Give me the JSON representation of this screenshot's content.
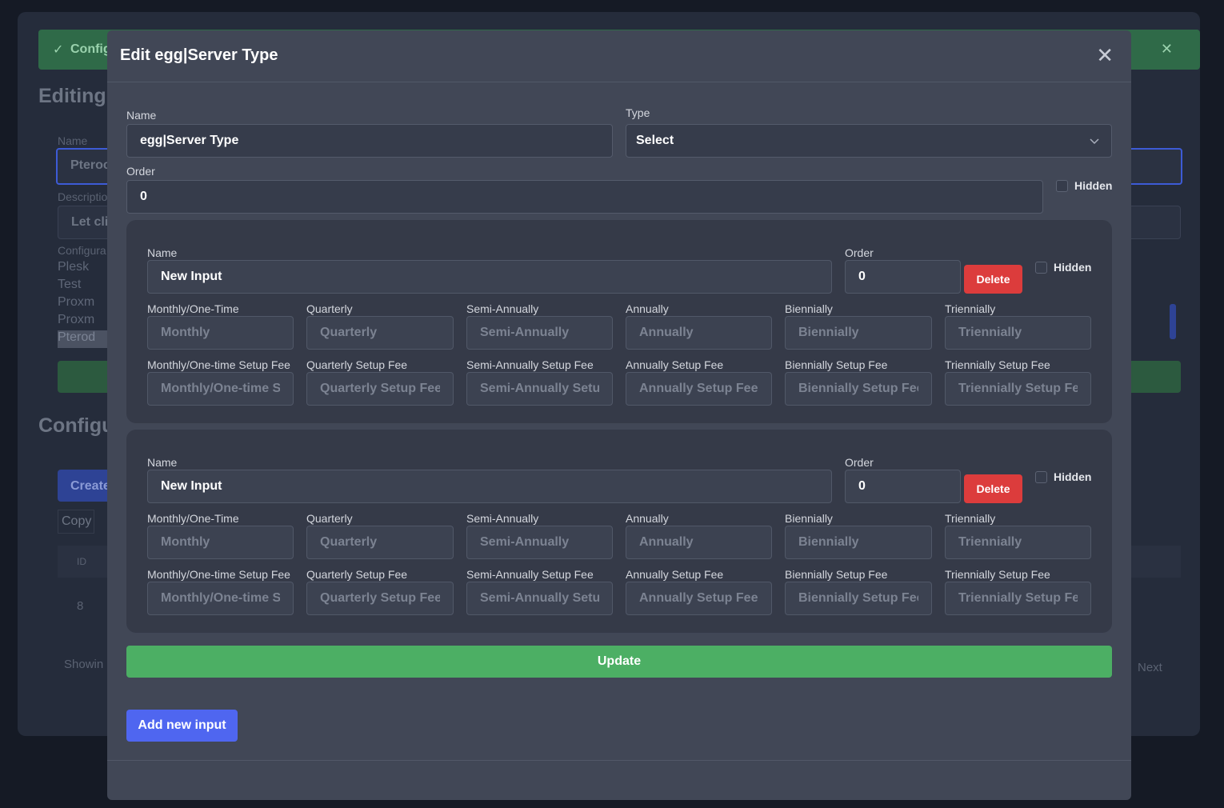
{
  "background": {
    "alert_text": "Config",
    "title": "Editing",
    "name_label": "Name",
    "name_value": "Pteroc",
    "description_label": "Descriptio",
    "description_value": "Let cli",
    "config_label": "Configura",
    "list_items": [
      "Plesk",
      "Test",
      "Proxm",
      "Proxm",
      "Pterod"
    ],
    "section_title": "Configu",
    "create_label": "Create",
    "copy_label": "Copy",
    "col_id": "ID",
    "row_id": "8",
    "showing": "Showin",
    "next": "Next"
  },
  "modal": {
    "title": "Edit egg|Server Type",
    "close_icon": "close-icon",
    "name_label": "Name",
    "name_value": "egg|Server Type",
    "type_label": "Type",
    "type_value": "Select",
    "order_label": "Order",
    "order_value": "0",
    "hidden_label": "Hidden",
    "update_label": "Update",
    "add_label": "Add new input"
  },
  "inputs": [
    {
      "name_label": "Name",
      "name_value": "New Input",
      "order_label": "Order",
      "order_value": "0",
      "delete_label": "Delete",
      "hidden_label": "Hidden",
      "price_labels": [
        "Monthly/One-Time",
        "Quarterly",
        "Semi-Annually",
        "Annually",
        "Biennially",
        "Triennially"
      ],
      "price_placeholders": [
        "Monthly",
        "Quarterly",
        "Semi-Annually",
        "Annually",
        "Biennially",
        "Triennially"
      ],
      "fee_labels": [
        "Monthly/One-time Setup Fee",
        "Quarterly Setup Fee",
        "Semi-Annually Setup Fee",
        "Annually Setup Fee",
        "Biennially Setup Fee",
        "Triennially Setup Fee"
      ],
      "fee_placeholders": [
        "Monthly/One-time Setup Fee",
        "Quarterly Setup Fee",
        "Semi-Annually Setup Fee",
        "Annually Setup Fee",
        "Biennially Setup Fee",
        "Triennially Setup Fee"
      ]
    },
    {
      "name_label": "Name",
      "name_value": "New Input",
      "order_label": "Order",
      "order_value": "0",
      "delete_label": "Delete",
      "hidden_label": "Hidden",
      "price_labels": [
        "Monthly/One-Time",
        "Quarterly",
        "Semi-Annually",
        "Annually",
        "Biennially",
        "Triennially"
      ],
      "price_placeholders": [
        "Monthly",
        "Quarterly",
        "Semi-Annually",
        "Annually",
        "Biennially",
        "Triennially"
      ],
      "fee_labels": [
        "Monthly/One-time Setup Fee",
        "Quarterly Setup Fee",
        "Semi-Annually Setup Fee",
        "Annually Setup Fee",
        "Biennially Setup Fee",
        "Triennially Setup Fee"
      ],
      "fee_placeholders": [
        "Monthly/One-time Setup Fee",
        "Quarterly Setup Fee",
        "Semi-Annually Setup Fee",
        "Annually Setup Fee",
        "Biennially Setup Fee",
        "Triennially Setup Fee"
      ]
    }
  ]
}
